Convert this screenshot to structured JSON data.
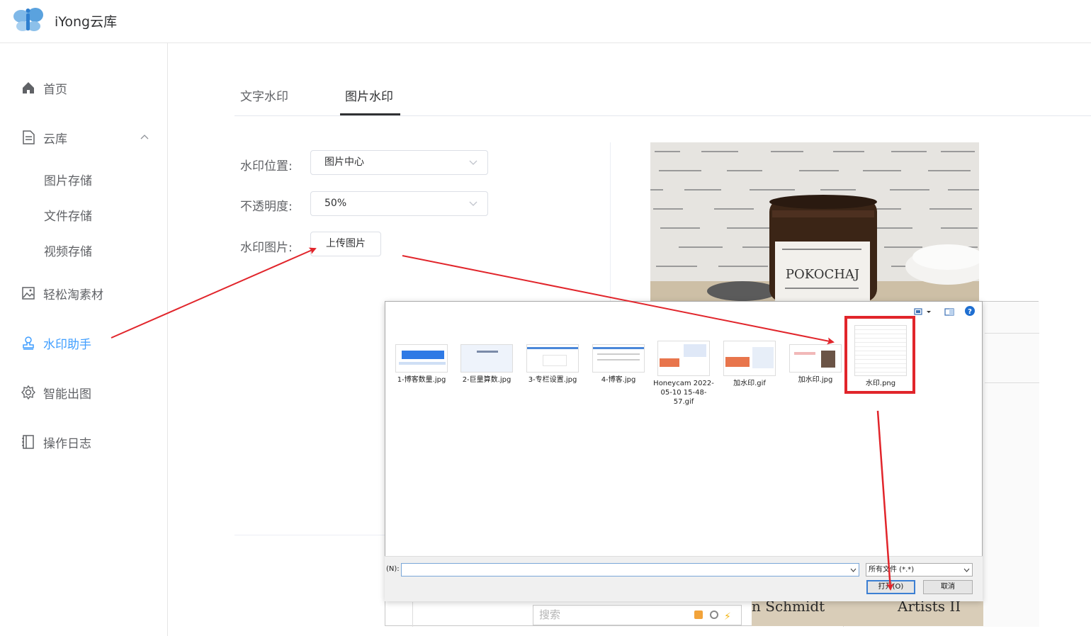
{
  "header": {
    "title": "iYong云库"
  },
  "sidebar": {
    "items": [
      {
        "label": "首页",
        "icon": "home-icon"
      },
      {
        "label": "云库",
        "icon": "document-icon"
      },
      {
        "label": "轻松淘素材",
        "icon": "image-icon"
      },
      {
        "label": "水印助手",
        "icon": "stamp-icon",
        "active": true
      },
      {
        "label": "智能出图",
        "icon": "gear-icon"
      },
      {
        "label": "操作日志",
        "icon": "notebook-icon"
      }
    ],
    "subitems": [
      "图片存储",
      "文件存储",
      "视频存储"
    ]
  },
  "tabs": [
    {
      "label": "文字水印"
    },
    {
      "label": "图片水印",
      "active": true
    }
  ],
  "form": {
    "position_label": "水印位置:",
    "position_value": "图片中心",
    "opacity_label": "不透明度:",
    "opacity_value": "50%",
    "image_label": "水印图片:",
    "upload_button": "上传图片"
  },
  "preview": {
    "jar_text": "POKOCHAJ"
  },
  "dialog": {
    "files": [
      {
        "name": "1-博客数量.jpg"
      },
      {
        "name": "2-巨量算数.jpg"
      },
      {
        "name": "3-专栏设置.jpg"
      },
      {
        "name": "4-博客.jpg"
      },
      {
        "name": "Honeycam 2022-05-10 15-48-57.gif"
      },
      {
        "name": "加水印.gif"
      },
      {
        "name": "加水印.jpg"
      },
      {
        "name": "水印.png",
        "selected": true
      }
    ],
    "filename_label": "(N):",
    "filename_value": "",
    "filetype": "所有文件 (*.*)",
    "open_button": "打开(O)",
    "cancel_button": "取消"
  },
  "background": {
    "search_placeholder": "搜索",
    "strip_text_1": "n Schmidt",
    "strip_text_2": "Artists II"
  },
  "colors": {
    "accent": "#409eff",
    "annotation": "#e1252b"
  }
}
